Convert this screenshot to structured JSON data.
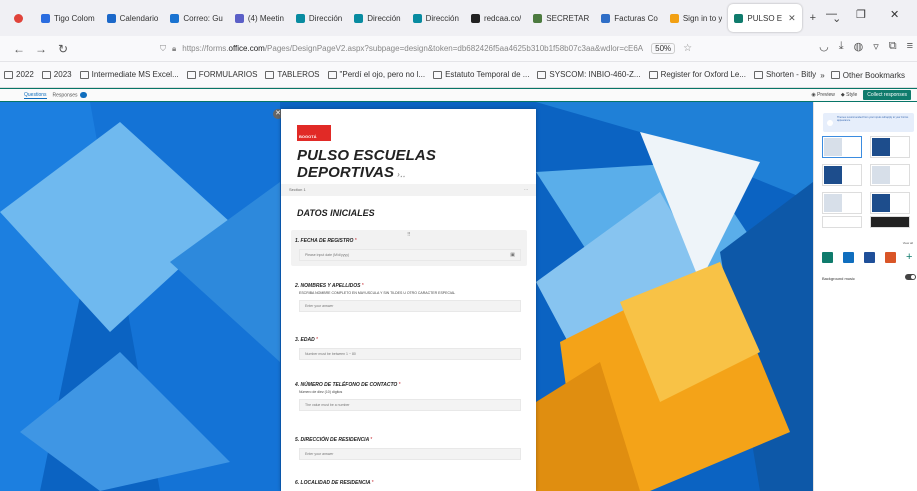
{
  "browser": {
    "tabs": [
      {
        "label": "Tigo Colom",
        "color": "#2b6de0"
      },
      {
        "label": "Calendario",
        "color": "#1b68c9"
      },
      {
        "label": "Correo: Gu",
        "color": "#1a73d1"
      },
      {
        "label": "(4) Meetin",
        "color": "#5b5fc7"
      },
      {
        "label": "Dirección",
        "color": "#088ba0"
      },
      {
        "label": "Dirección",
        "color": "#088ba0"
      },
      {
        "label": "Dirección",
        "color": "#088ba0"
      },
      {
        "label": "redcaa.co/",
        "color": "#222222"
      },
      {
        "label": "SECRETAR",
        "color": "#4c7a3f"
      },
      {
        "label": "Facturas Co",
        "color": "#2f6ec7"
      },
      {
        "label": "Sign in to y",
        "color": "#f2a013"
      },
      {
        "label": "PULSO E",
        "color": "#0f7b6c",
        "active": true
      }
    ],
    "url_prefix": "https://forms.",
    "url_domain": "office.com",
    "url_rest": "/Pages/DesignPageV2.aspx?subpage=design&token=db682426f5aa4625b310b1f58b07c3aa&wdlor=cE6A",
    "zoom": "50%",
    "bookmarks": [
      "2022",
      "2023",
      "Intermediate MS Excel...",
      "FORMULARIOS",
      "TABLEROS",
      "\"Perdí el ojo, pero no l...",
      "Estatuto Temporal de ...",
      "SYSCOM: INBIO-460-Z...",
      "Register for Oxford Le...",
      "Shorten - Bitly"
    ],
    "other_bookmarks": "Other Bookmarks"
  },
  "forms": {
    "tab_questions": "Questions",
    "tab_responses": "Responses",
    "responses_count": "3",
    "preview": "Preview",
    "style": "Style",
    "collect": "Collect responses"
  },
  "form": {
    "logo_text": "BOGOTÁ",
    "title": "PULSO ESCUELAS  DEPORTIVAS",
    "section_label": "Section 1",
    "section_title": "DATOS INICIALES",
    "questions": [
      {
        "label": "1. FECHA DE REGISTRO",
        "required": "*",
        "sub": "",
        "placeholder": "Please input date (M/d/yyyy)"
      },
      {
        "label": "2. NOMBRES Y APELLIDOS",
        "required": "*",
        "sub": "ESCRIBA  NOMBRE COMPLETO EN MAYUSCULA Y SIN TILDES U OTRO CARACTER ESPECIAL",
        "placeholder": "Enter your answer"
      },
      {
        "label": "3. EDAD",
        "required": "*",
        "sub": "",
        "placeholder": "Number must be between 1 ~ 80"
      },
      {
        "label": "4. NÚMERO DE TELÉFONO DE CONTACTO",
        "required": "*",
        "sub": "Número de diez (10) dígitos",
        "placeholder": "The value must be a number"
      },
      {
        "label": "5. DIRECCIÓN DE RESIDENCIA",
        "required": "*",
        "sub": "",
        "placeholder": "Enter your answer"
      },
      {
        "label": "6. LOCALIDAD DE RESIDENCIA",
        "required": "*",
        "sub": "",
        "placeholder": ""
      }
    ]
  },
  "sidebar": {
    "banner": "Themes recommended from your inputs will apply to your Forms appearance",
    "view_all": "View all",
    "swatches": [
      "#0f7b6c",
      "#106ebe",
      "#1f4f99",
      "#d95527"
    ],
    "background_music": "Background music"
  }
}
